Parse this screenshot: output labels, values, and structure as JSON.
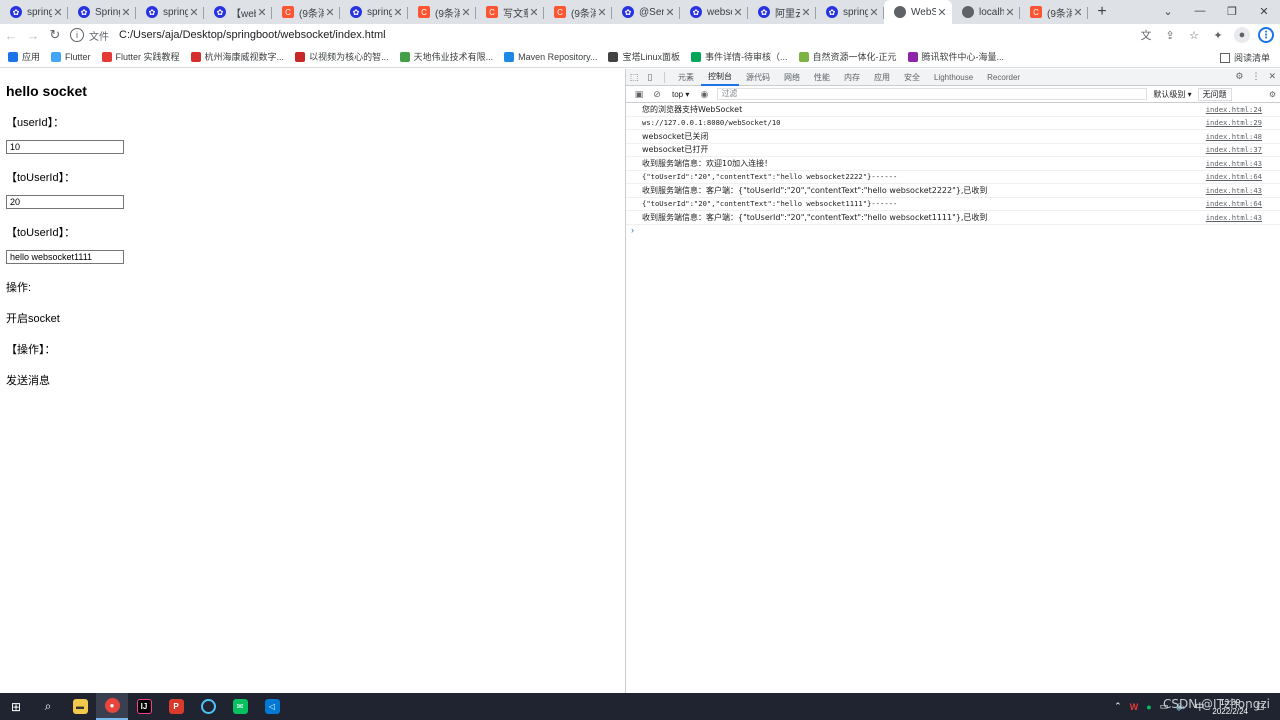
{
  "browser": {
    "tabs": [
      {
        "title": "spring",
        "icon": "baidu-paw-icon"
      },
      {
        "title": "Spring",
        "icon": "baidu-paw-icon"
      },
      {
        "title": "spring",
        "icon": "baidu-paw-icon"
      },
      {
        "title": "【web",
        "icon": "baidu-paw-icon"
      },
      {
        "title": "(9条消",
        "icon": "csdn-icon"
      },
      {
        "title": "spring",
        "icon": "baidu-paw-icon"
      },
      {
        "title": "(9条消",
        "icon": "csdn-icon"
      },
      {
        "title": "写文章",
        "icon": "csdn-icon"
      },
      {
        "title": "(9条消",
        "icon": "csdn-icon"
      },
      {
        "title": "@Serv",
        "icon": "baidu-paw-icon"
      },
      {
        "title": "webso",
        "icon": "baidu-paw-icon"
      },
      {
        "title": "阿里云",
        "icon": "baidu-paw-icon"
      },
      {
        "title": "spring",
        "icon": "baidu-paw-icon"
      },
      {
        "title": "WebS",
        "icon": "globe-icon",
        "active": true
      },
      {
        "title": "localh",
        "icon": "globe-icon"
      },
      {
        "title": "(9条消",
        "icon": "csdn-icon"
      }
    ],
    "address": {
      "scheme_label": "文件",
      "url": "C:/Users/aja/Desktop/springboot/websocket/index.html"
    },
    "bookmarks": [
      {
        "label": "应用",
        "icon": "apps-grid-icon",
        "color": "#1a73e8"
      },
      {
        "label": "Flutter",
        "icon": "flutter-icon",
        "color": "#42a5f5"
      },
      {
        "label": "Flutter 实践教程",
        "icon": "flutter-icon",
        "color": "#e53935"
      },
      {
        "label": "杭州海康威视数字...",
        "icon": "hikvision-icon",
        "color": "#d32f2f"
      },
      {
        "label": "以视频为核心的智...",
        "icon": "dahua-icon",
        "color": "#c62828"
      },
      {
        "label": "天地伟业技术有限...",
        "icon": "tiandy-icon",
        "color": "#43a047"
      },
      {
        "label": "Maven Repository...",
        "icon": "maven-icon",
        "color": "#1e88e5"
      },
      {
        "label": "宝塔Linux面板",
        "icon": "bt-icon",
        "color": "#424242"
      },
      {
        "label": "事件详情-待审核（...",
        "icon": "event-icon",
        "color": "#00a65a"
      },
      {
        "label": "自然资源一体化-正元",
        "icon": "check-icon",
        "color": "#7cb342"
      },
      {
        "label": "腾讯软件中心-海量...",
        "icon": "tencent-icon",
        "color": "#8e24aa"
      }
    ],
    "reading_list": "阅读清单"
  },
  "page": {
    "title": "hello socket",
    "userId_label": "【userId】：",
    "userId_value": "10",
    "toUserId_label": "【toUserId】：",
    "toUserId_value": "20",
    "content_label": "【toUserId】：",
    "content_value": "hello websocket1111",
    "action_label": "操作:",
    "open_socket": "开启socket",
    "action_label2": "【操作】：",
    "send_message": "发送消息"
  },
  "devtools": {
    "tabs": [
      "元素",
      "控制台",
      "源代码",
      "网络",
      "性能",
      "内存",
      "应用",
      "安全",
      "Lighthouse",
      "Recorder"
    ],
    "active_tab": "控制台",
    "context": "top",
    "filter_placeholder": "过滤",
    "levels": "默认级别",
    "issues": "无问题",
    "console": [
      {
        "msg": "您的浏览器支持WebSocket",
        "src": "index.html:24",
        "cn": true
      },
      {
        "msg": "ws://127.0.0.1:8080/webSocket/10",
        "src": "index.html:29",
        "cn": false
      },
      {
        "msg": "websocket已关闭",
        "src": "index.html:48",
        "cn": true
      },
      {
        "msg": "websocket已打开",
        "src": "index.html:37",
        "cn": true
      },
      {
        "msg": "收到服务端信息：欢迎10加入连接！",
        "src": "index.html:43",
        "cn": true
      },
      {
        "msg": "{\"toUserId\":\"20\",\"contentText\":\"hello websocket2222\"}------",
        "src": "index.html:64",
        "cn": false
      },
      {
        "msg": "收到服务端信息：客户端：{\"toUserId\":\"20\",\"contentText\":\"hello websocket2222\"},已收到",
        "src": "index.html:43",
        "cn": true
      },
      {
        "msg": "{\"toUserId\":\"20\",\"contentText\":\"hello websocket1111\"}------",
        "src": "index.html:64",
        "cn": false
      },
      {
        "msg": "收到服务端信息：客户端：{\"toUserId\":\"20\",\"contentText\":\"hello websocket1111\"},已收到",
        "src": "index.html:43",
        "cn": true
      }
    ]
  },
  "taskbar": {
    "ime": "中",
    "time": "13:09",
    "date": "2022/2/24",
    "watermark": "CSDN @ITzhongzi"
  }
}
